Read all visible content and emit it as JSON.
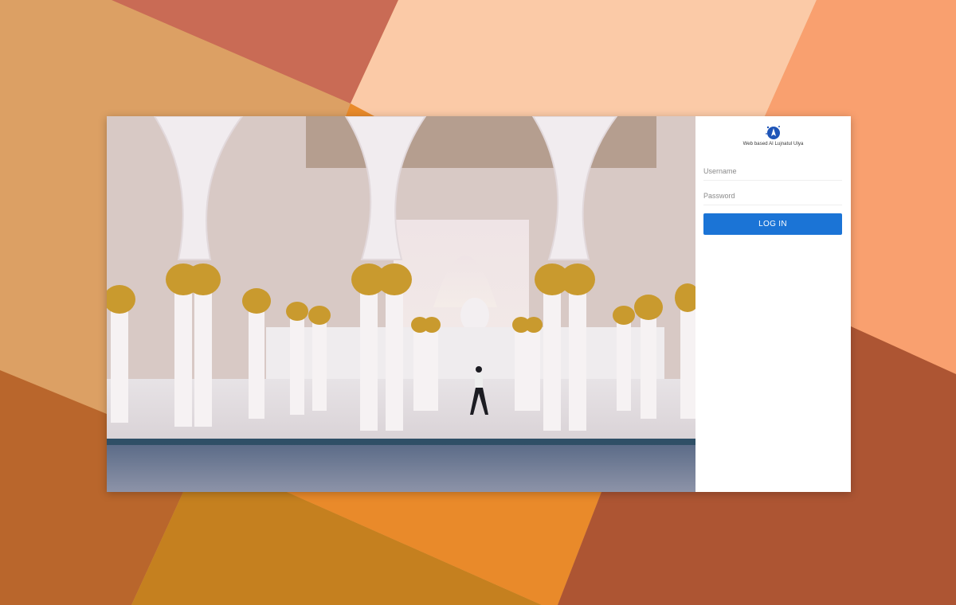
{
  "app": {
    "logo_icon": "mosque-star-logo-icon",
    "subtitle": "Web based Al Lujnatul Ulya"
  },
  "login_form": {
    "username_placeholder": "Username",
    "password_placeholder": "Password",
    "submit_label": "LOG IN"
  },
  "colors": {
    "button": "#1b74d6",
    "panel_bg": "#ffffff",
    "bg_shapes": [
      "#dca064",
      "#c96b55",
      "#fbcaa7",
      "#f9a06f",
      "#b9662c",
      "#c5801f",
      "#e98a2a",
      "#ad5533"
    ]
  },
  "hero_image": {
    "subject": "mosque-arcade-photo"
  }
}
